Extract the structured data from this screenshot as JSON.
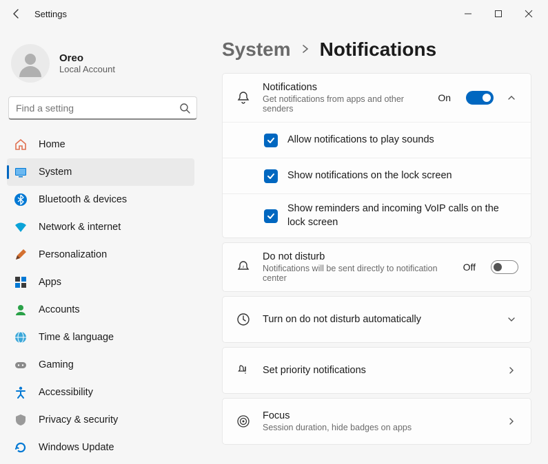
{
  "window": {
    "title": "Settings"
  },
  "user": {
    "name": "Oreo",
    "sub": "Local Account"
  },
  "search": {
    "placeholder": "Find a setting"
  },
  "sidebar": {
    "items": [
      {
        "label": "Home"
      },
      {
        "label": "System"
      },
      {
        "label": "Bluetooth & devices"
      },
      {
        "label": "Network & internet"
      },
      {
        "label": "Personalization"
      },
      {
        "label": "Apps"
      },
      {
        "label": "Accounts"
      },
      {
        "label": "Time & language"
      },
      {
        "label": "Gaming"
      },
      {
        "label": "Accessibility"
      },
      {
        "label": "Privacy & security"
      },
      {
        "label": "Windows Update"
      }
    ]
  },
  "breadcrumb": {
    "parent": "System",
    "current": "Notifications"
  },
  "notifications": {
    "title": "Notifications",
    "sub": "Get notifications from apps and other senders",
    "state": "On",
    "sub1": "Allow notifications to play sounds",
    "sub2": "Show notifications on the lock screen",
    "sub3": "Show reminders and incoming VoIP calls on the lock screen"
  },
  "dnd": {
    "title": "Do not disturb",
    "sub": "Notifications will be sent directly to notification center",
    "state": "Off"
  },
  "auto_dnd": {
    "title": "Turn on do not disturb automatically"
  },
  "priority": {
    "title": "Set priority notifications"
  },
  "focus": {
    "title": "Focus",
    "sub": "Session duration, hide badges on apps"
  }
}
